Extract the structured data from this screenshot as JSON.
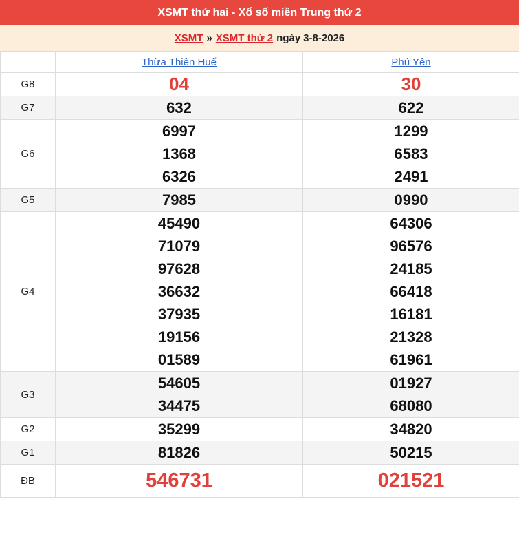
{
  "header": {
    "title": "XSMT thứ hai - Xổ số miền Trung thứ 2"
  },
  "breadcrumb": {
    "link1": "XSMT",
    "separator": "»",
    "link2": "XSMT thứ 2",
    "date_prefix": "ngày",
    "date": "3-8-2026"
  },
  "provinces": [
    "Thừa Thiên Huế",
    "Phú Yên"
  ],
  "prizes": [
    {
      "label": "G8",
      "a": [
        "04"
      ],
      "b": [
        "30"
      ]
    },
    {
      "label": "G7",
      "a": [
        "632"
      ],
      "b": [
        "622"
      ]
    },
    {
      "label": "G6",
      "a": [
        "6997",
        "1368",
        "6326"
      ],
      "b": [
        "1299",
        "6583",
        "2491"
      ]
    },
    {
      "label": "G5",
      "a": [
        "7985"
      ],
      "b": [
        "0990"
      ]
    },
    {
      "label": "G4",
      "a": [
        "45490",
        "71079",
        "97628",
        "36632",
        "37935",
        "19156",
        "01589"
      ],
      "b": [
        "64306",
        "96576",
        "24185",
        "66418",
        "16181",
        "21328",
        "61961"
      ]
    },
    {
      "label": "G3",
      "a": [
        "54605",
        "34475"
      ],
      "b": [
        "01927",
        "68080"
      ]
    },
    {
      "label": "G2",
      "a": [
        "35299"
      ],
      "b": [
        "34820"
      ]
    },
    {
      "label": "G1",
      "a": [
        "81826"
      ],
      "b": [
        "50215"
      ]
    },
    {
      "label": "ĐB",
      "a": [
        "546731"
      ],
      "b": [
        "021521"
      ]
    }
  ],
  "colors": {
    "header_bg": "#e8473e",
    "breadcrumb_bg": "#fdeedc",
    "link_red": "#d8262c",
    "link_blue": "#2e66c8",
    "special_red": "#e0413a",
    "shade": "#f4f4f4"
  }
}
